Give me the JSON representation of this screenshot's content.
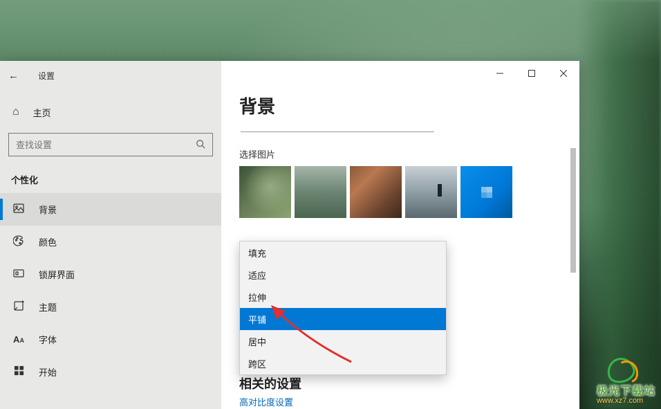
{
  "window": {
    "title": "设置",
    "back_label": "←"
  },
  "sidebar": {
    "home_label": "主页",
    "search_placeholder": "查找设置",
    "category": "个性化",
    "items": [
      {
        "icon": "picture",
        "label": "背景",
        "active": true
      },
      {
        "icon": "palette",
        "label": "颜色"
      },
      {
        "icon": "lockscreen",
        "label": "锁屏界面"
      },
      {
        "icon": "theme",
        "label": "主题"
      },
      {
        "icon": "font",
        "label": "字体"
      },
      {
        "icon": "start",
        "label": "开始"
      }
    ]
  },
  "main": {
    "page_title": "背景",
    "section_pick": "选择图片",
    "dropdown_options": [
      "填充",
      "适应",
      "拉伸",
      "平铺",
      "居中",
      "跨区"
    ],
    "dropdown_selected": "平铺",
    "related_title": "相关的设置",
    "related_link": "高对比度设置"
  },
  "watermark": {
    "text": "极光下载站",
    "url": "www.xz7.com"
  }
}
